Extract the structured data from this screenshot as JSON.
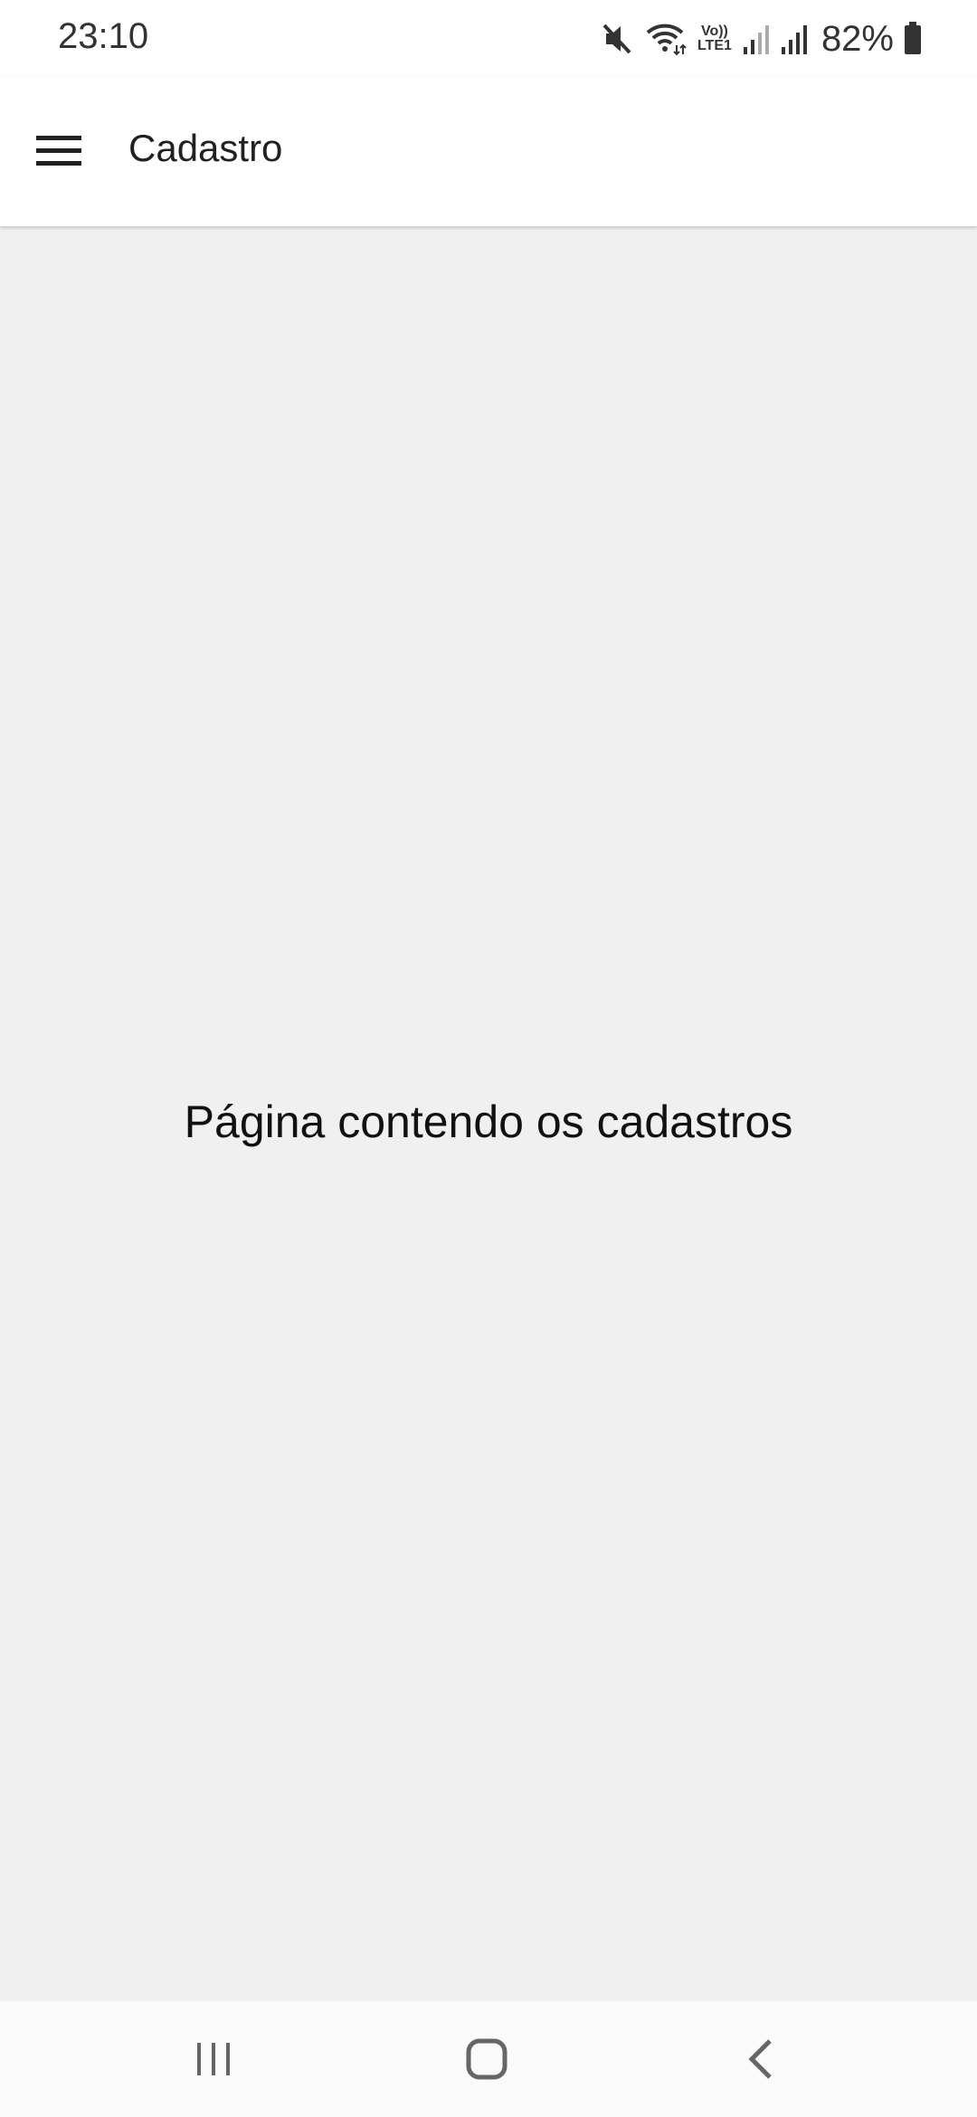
{
  "status_bar": {
    "time": "23:10",
    "icons": [
      "mute-icon",
      "wifi-icon",
      "volte-lte-icon",
      "signal-icon",
      "signal-icon"
    ],
    "volte_top": "Vo))",
    "volte_bottom": "LTE1",
    "battery_percent": "82%"
  },
  "app_bar": {
    "menu_icon": "hamburger-menu-icon",
    "title": "Cadastro"
  },
  "content": {
    "message": "Página contendo os cadastros"
  },
  "nav_bar": {
    "recents_icon": "recents-icon",
    "home_icon": "home-icon",
    "back_icon": "back-icon"
  },
  "colors": {
    "app_bar_bg": "#ffffff",
    "content_bg": "#f0f0f0",
    "text_primary": "#212121"
  }
}
